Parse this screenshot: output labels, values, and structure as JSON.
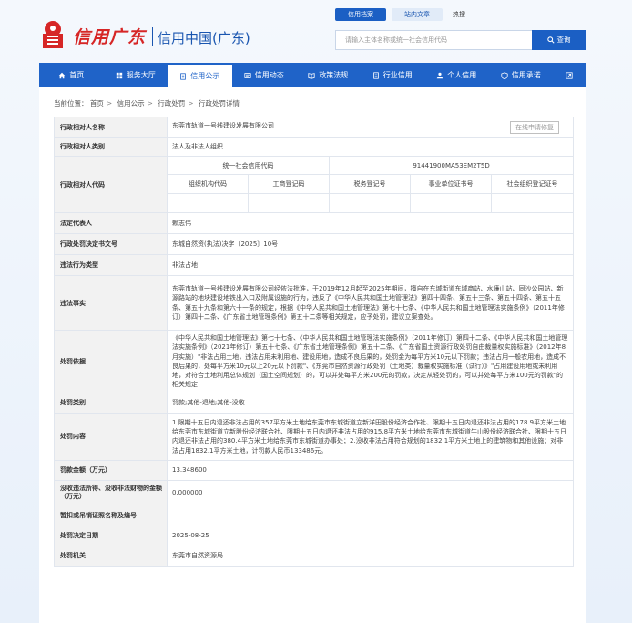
{
  "header": {
    "brand_script": "信用广东",
    "brand_name": "信用中国(广东)",
    "search_tabs": [
      "信用档案",
      "站内文章"
    ],
    "hot_label": "热搜",
    "search_placeholder": "请输入主体名称或统一社会信用代码",
    "search_button": "查询"
  },
  "nav": {
    "items": [
      {
        "label": "首页",
        "icon": "home-icon"
      },
      {
        "label": "服务大厅",
        "icon": "grid-icon"
      },
      {
        "label": "信用公示",
        "icon": "document-icon"
      },
      {
        "label": "信用动态",
        "icon": "news-icon"
      },
      {
        "label": "政策法规",
        "icon": "book-icon"
      },
      {
        "label": "行业信用",
        "icon": "building-icon"
      },
      {
        "label": "个人信用",
        "icon": "person-icon"
      },
      {
        "label": "信用承诺",
        "icon": "shield-icon"
      }
    ],
    "active_index": 2
  },
  "breadcrumb": {
    "prefix": "当前位置：",
    "items": [
      "首页",
      "信用公示",
      "行政处罚",
      "行政处罚详情"
    ]
  },
  "detail": {
    "rows": {
      "party_name_label": "行政相对人名称",
      "party_name": "东莞市轨道一号线建设发展有限公司",
      "apply_button": "在线申请修复",
      "party_type_label": "行政相对人类别",
      "party_type": "法人及非法人组织",
      "party_code_label": "行政相对人代码",
      "uscc_label": "统一社会信用代码",
      "uscc": "91441900MA53EM2T5D",
      "code_headers": [
        "组织机构代码",
        "工商登记码",
        "税务登记号",
        "事业单位证书号",
        "社会组织登记证号"
      ],
      "code_values": [
        "",
        "",
        "",
        "",
        ""
      ],
      "legal_rep_label": "法定代表人",
      "legal_rep": "赖志伟",
      "doc_no_label": "行政处罚决定书文号",
      "doc_no": "东城自然资(执法)决字〔2025〕10号",
      "violation_type_label": "违法行为类型",
      "violation_type": "非法占地",
      "facts_label": "违法事实",
      "facts": "东莞市轨道一号线建设发展有限公司经依法批准，于2019年12月起至2025年期间，擅自在东城街道东城商站、水濂山站、同沙公园站、新源路站的地块建设地铁出入口及附属设施的行为，违反了《中华人民共和国土地管理法》第四十四条、第五十三条、第五十四条、第五十五条、第五十九条和第六十一条的规定，根据《中华人民共和国土地管理法》第七十七条、《中华人民共和国土地管理法实施条例》（2011年修订）第四十二条、《广东省土地管理条例》第五十二条等相关规定，应予处罚，建议立案查处。",
      "basis_label": "处罚依据",
      "basis": "《中华人民共和国土地管理法》第七十七条、《中华人民共和国土地管理法实施条例》（2011年修订）第四十二条、《中华人民共和国土地管理法实施条例》（2021年修订）第五十七条、《广东省土地管理条例》第五十二条、《广东省国土资源行政处罚自由裁量权实施标准》（2012年8月实施）\"非法占用土地，违法占用未利用地、建设用地，造成不良后果的，处罚金为每平方米10元以下罚款；违法占用一般农用地，造成不良后果的，处每平方米10元以上20元以下罚款\"、《东莞市自然资源行政处罚（土地类）裁量权实施标准（试行）》\"占用建设用地或未利用地，对符合土地利用总体规划（国土空间规划）的，可以并处每平方米200元的罚款，决定从轻处罚的，可以并处每平方米100元的罚款\"的相关规定",
      "penalty_type_label": "处罚类别",
      "penalty_type": "罚款;其他-退地;其他-没收",
      "content_label": "处罚内容",
      "content": "1.限期十五日内退还非法占用的357平方米土地给东莞市东城街道立新洋田股份经济合作社、限期十五日内退还非法占用的178.9平方米土地给东莞市东城街道立新股份经济联合社、限期十五日内退还非法占用的915.8平方米土地给东莞市东城街道牛山股份经济联合社、限期十五日内退还非法占用的380.4平方米土地给东莞市东城街道办事处；2.没收非法占用符合规划的1832.1平方米土地上的建筑物和其他设施；对非法占用1832.1平方米土地，计罚款人民币133486元。",
      "amount_label": "罚款金额（万元）",
      "amount": "13.348600",
      "confiscation_label": "没收违法所得、没收非法财物的金额（万元）",
      "confiscation": "0.000000",
      "license_label": "暂扣或吊销证照名称及编号",
      "license": "",
      "decision_date_label": "处罚决定日期",
      "decision_date": "2025-08-25",
      "authority_label": "处罚机关",
      "authority": "东莞市自然资源局"
    }
  },
  "colors": {
    "primary": "#1f63c8",
    "brand_red": "#d62626",
    "label_bg": "#f2f2f2"
  }
}
